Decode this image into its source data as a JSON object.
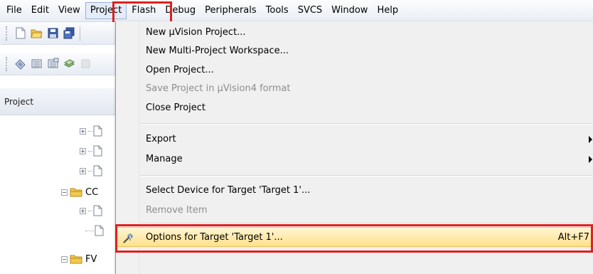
{
  "menubar": {
    "items": [
      {
        "label": "File"
      },
      {
        "label": "Edit"
      },
      {
        "label": "View"
      },
      {
        "label": "Project"
      },
      {
        "label": "Flash"
      },
      {
        "label": "Debug"
      },
      {
        "label": "Peripherals"
      },
      {
        "label": "Tools"
      },
      {
        "label": "SVCS"
      },
      {
        "label": "Window"
      },
      {
        "label": "Help"
      }
    ],
    "active": "Project"
  },
  "panel": {
    "title": "Project",
    "tree_folders": [
      {
        "label": "CC",
        "icon": "folder-icon"
      },
      {
        "label": "FV",
        "icon": "folder-icon"
      }
    ]
  },
  "project_menu": {
    "items": [
      {
        "label": "New µVision Project..."
      },
      {
        "label": "New Multi-Project Workspace..."
      },
      {
        "label": "Open Project..."
      },
      {
        "label": "Save Project in µVision4 format",
        "state": "disabled"
      },
      {
        "label": "Close Project"
      },
      {
        "label": "Export",
        "submenu": true
      },
      {
        "label": "Manage",
        "submenu": true
      },
      {
        "label": "Select Device for Target 'Target 1'..."
      },
      {
        "label": "Remove Item",
        "state": "disabled"
      },
      {
        "label": "Options for Target 'Target 1'...",
        "shortcut": "Alt+F7",
        "icon": "magic-wand-icon",
        "state": "highlighted"
      }
    ]
  },
  "colors": {
    "highlight_outline": "#e02020",
    "menu_highlight": "#ffe08b",
    "disabled_text": "#8d8d8d"
  }
}
